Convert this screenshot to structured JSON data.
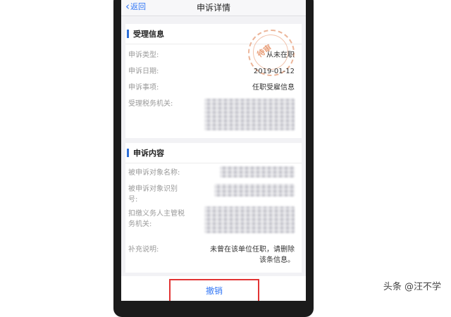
{
  "nav": {
    "back_label": "返回",
    "title": "申诉详情"
  },
  "section1": {
    "title": "受理信息",
    "rows": [
      {
        "label": "申诉类型:",
        "value": "从未在职"
      },
      {
        "label": "申诉日期:",
        "value": "2019-01-12"
      },
      {
        "label": "申诉事项:",
        "value": "任职受雇信息"
      },
      {
        "label": "受理税务机关:",
        "value": ""
      }
    ],
    "stamp_text": "待审"
  },
  "section2": {
    "title": "申诉内容",
    "rows": [
      {
        "label": "被申诉对象名称:",
        "value": ""
      },
      {
        "label_line1": "被申诉对象识别",
        "label_line2": "号:",
        "value": ""
      },
      {
        "label_line1": "扣缴义务人主管税",
        "label_line2": "务机关:",
        "value": ""
      },
      {
        "label": "补充说明:",
        "value_line1": "未曾在该单位任职，请删除",
        "value_line2": "该条信息。"
      }
    ]
  },
  "footer": {
    "cancel_label": "撤销"
  },
  "watermark": "头条 @汪不学",
  "colors": {
    "accent": "#3478f6",
    "highlight": "#e23434",
    "section_bar": "#2f6fd6"
  }
}
